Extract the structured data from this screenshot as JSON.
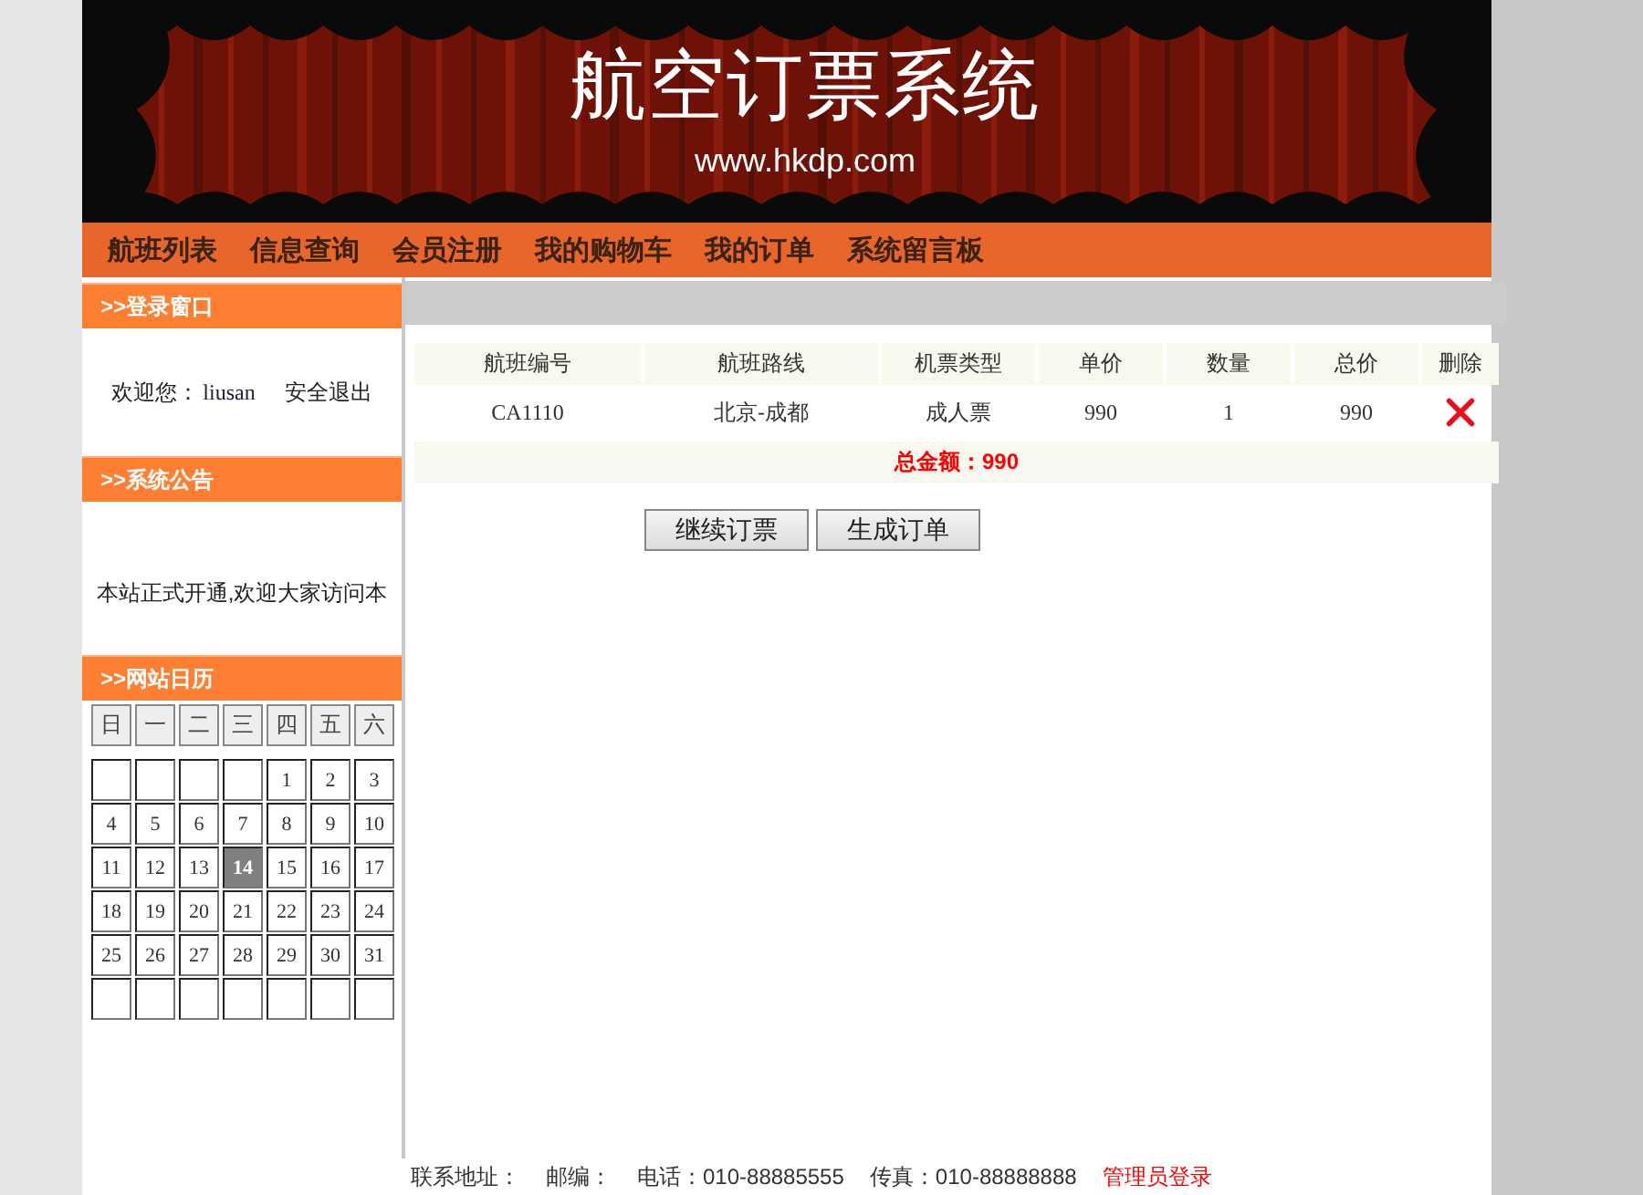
{
  "header": {
    "title": "航空订票系统",
    "url": "www.hkdp.com"
  },
  "nav": [
    {
      "label": "航班列表"
    },
    {
      "label": "信息查询"
    },
    {
      "label": "会员注册"
    },
    {
      "label": "我的购物车"
    },
    {
      "label": "我的订单"
    },
    {
      "label": "系统留言板"
    }
  ],
  "login_panel": {
    "heading": ">>登录窗口",
    "welcome": "欢迎您：",
    "username": "liusan",
    "logout": "安全退出"
  },
  "notice_panel": {
    "heading": ">>系统公告",
    "text": "本站正式开通,欢迎大家访问本"
  },
  "calendar_panel": {
    "heading": ">>网站日历",
    "weekdays": [
      "日",
      "一",
      "二",
      "三",
      "四",
      "五",
      "六"
    ],
    "weeks": [
      [
        {
          "kind": "blank"
        },
        {
          "kind": "blank"
        },
        {
          "kind": "blank"
        },
        {
          "kind": "blank"
        },
        {
          "kind": "day",
          "label": "1",
          "selected": false
        },
        {
          "kind": "day",
          "label": "2",
          "selected": false
        },
        {
          "kind": "day",
          "label": "3",
          "selected": false
        }
      ],
      [
        {
          "kind": "day",
          "label": "4",
          "selected": false
        },
        {
          "kind": "day",
          "label": "5",
          "selected": false
        },
        {
          "kind": "day",
          "label": "6",
          "selected": false
        },
        {
          "kind": "day",
          "label": "7",
          "selected": false
        },
        {
          "kind": "day",
          "label": "8",
          "selected": false
        },
        {
          "kind": "day",
          "label": "9",
          "selected": false
        },
        {
          "kind": "day",
          "label": "10",
          "selected": false
        }
      ],
      [
        {
          "kind": "day",
          "label": "11",
          "selected": false
        },
        {
          "kind": "day",
          "label": "12",
          "selected": false
        },
        {
          "kind": "day",
          "label": "13",
          "selected": false
        },
        {
          "kind": "day",
          "label": "14",
          "selected": true
        },
        {
          "kind": "day",
          "label": "15",
          "selected": false
        },
        {
          "kind": "day",
          "label": "16",
          "selected": false
        },
        {
          "kind": "day",
          "label": "17",
          "selected": false
        }
      ],
      [
        {
          "kind": "day",
          "label": "18",
          "selected": false
        },
        {
          "kind": "day",
          "label": "19",
          "selected": false
        },
        {
          "kind": "day",
          "label": "20",
          "selected": false
        },
        {
          "kind": "day",
          "label": "21",
          "selected": false
        },
        {
          "kind": "day",
          "label": "22",
          "selected": false
        },
        {
          "kind": "day",
          "label": "23",
          "selected": false
        },
        {
          "kind": "day",
          "label": "24",
          "selected": false
        }
      ],
      [
        {
          "kind": "day",
          "label": "25",
          "selected": false
        },
        {
          "kind": "day",
          "label": "26",
          "selected": false
        },
        {
          "kind": "day",
          "label": "27",
          "selected": false
        },
        {
          "kind": "day",
          "label": "28",
          "selected": false
        },
        {
          "kind": "day",
          "label": "29",
          "selected": false
        },
        {
          "kind": "day",
          "label": "30",
          "selected": false
        },
        {
          "kind": "day",
          "label": "31",
          "selected": false
        }
      ],
      [
        {
          "kind": "blank"
        },
        {
          "kind": "blank"
        },
        {
          "kind": "blank"
        },
        {
          "kind": "blank"
        },
        {
          "kind": "blank"
        },
        {
          "kind": "blank"
        },
        {
          "kind": "blank"
        }
      ]
    ]
  },
  "cart": {
    "columns": [
      "航班编号",
      "航班路线",
      "机票类型",
      "单价",
      "数量",
      "总价",
      "删除"
    ],
    "rows": [
      {
        "flight": "CA1110",
        "route": "北京-成都",
        "ticket_type": "成人票",
        "price": "990",
        "quantity": "1",
        "total": "990"
      }
    ],
    "total": "总金额：990",
    "buttons": [
      "继续订票",
      "生成订单"
    ]
  },
  "footer": {
    "address": "联系地址：",
    "postcode": "邮编：",
    "phone": "电话：010-88885555",
    "fax": "传真：010-88888888",
    "admin_link": "管理员登录"
  }
}
